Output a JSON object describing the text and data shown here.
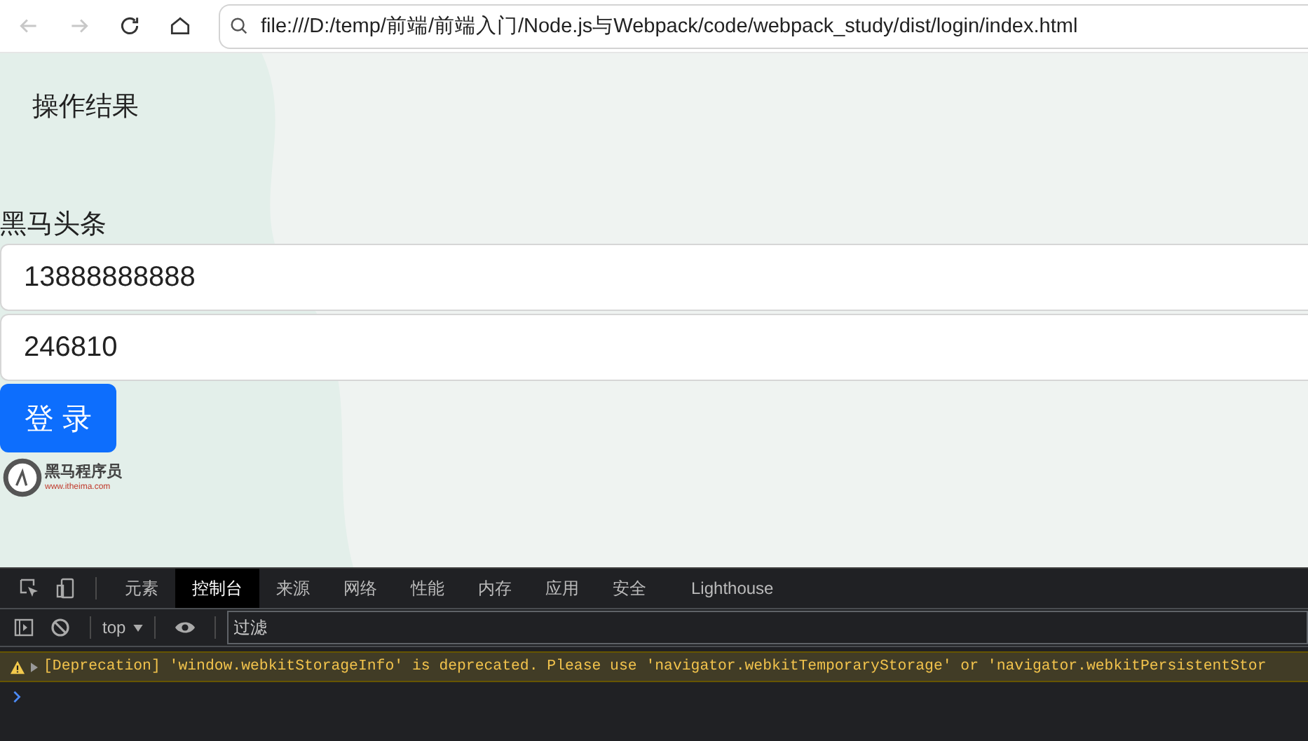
{
  "browser": {
    "url": "file:///D:/temp/前端/前端入门/Node.js与Webpack/code/webpack_study/dist/login/index.html"
  },
  "page": {
    "result_heading": "操作结果",
    "title": "黑马头条",
    "fields": [
      {
        "value": "13888888888"
      },
      {
        "value": "246810"
      }
    ],
    "login_button": "登 录",
    "logo": {
      "name": "黑马程序员",
      "site": "www.itheima.com"
    }
  },
  "devtools": {
    "tabs": [
      {
        "label": "元素",
        "selected": false
      },
      {
        "label": "控制台",
        "selected": true
      },
      {
        "label": "来源",
        "selected": false
      },
      {
        "label": "网络",
        "selected": false
      },
      {
        "label": "性能",
        "selected": false
      },
      {
        "label": "内存",
        "selected": false
      },
      {
        "label": "应用",
        "selected": false
      },
      {
        "label": "安全",
        "selected": false
      },
      {
        "label": "Lighthouse",
        "selected": false
      }
    ],
    "context": "top",
    "filter_placeholder": "过滤",
    "messages": [
      {
        "kind": "warning",
        "text": "[Deprecation] 'window.webkitStorageInfo' is deprecated. Please use 'navigator.webkitTemporaryStorage' or 'navigator.webkitPersistentStor"
      }
    ]
  }
}
